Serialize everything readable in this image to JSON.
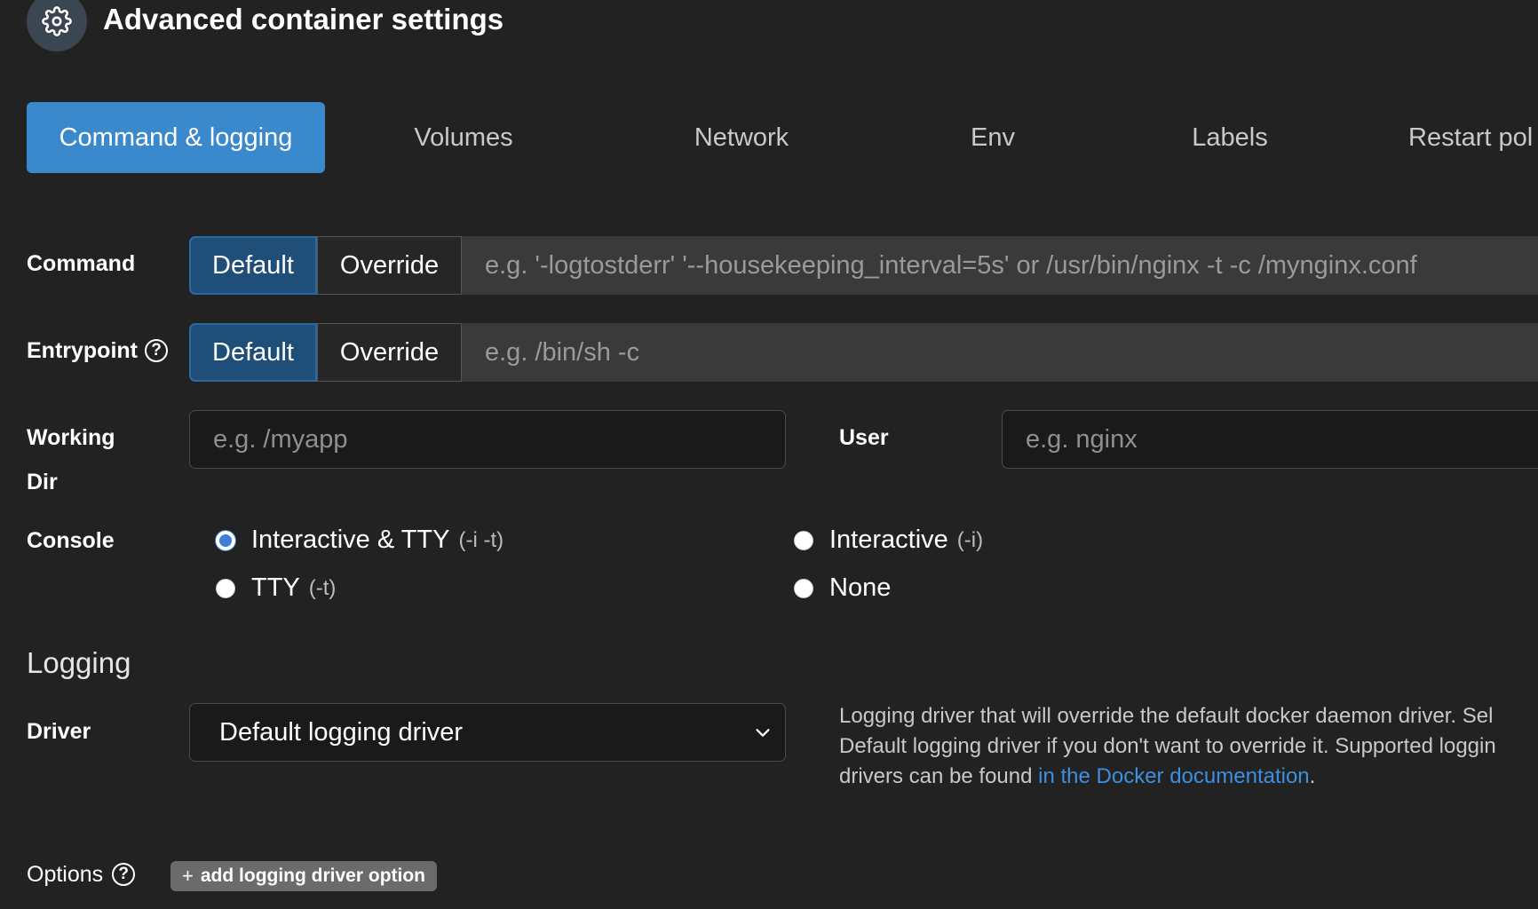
{
  "header": {
    "title": "Advanced container settings",
    "icon": "gear-icon"
  },
  "tabs": [
    {
      "label": "Command & logging",
      "active": true
    },
    {
      "label": "Volumes",
      "active": false
    },
    {
      "label": "Network",
      "active": false
    },
    {
      "label": "Env",
      "active": false
    },
    {
      "label": "Labels",
      "active": false
    },
    {
      "label": "Restart pol",
      "active": false
    }
  ],
  "command": {
    "label": "Command",
    "default_label": "Default",
    "override_label": "Override",
    "placeholder": "e.g. '-logtostderr' '--housekeeping_interval=5s' or /usr/bin/nginx -t -c /mynginx.conf"
  },
  "entrypoint": {
    "label": "Entrypoint",
    "default_label": "Default",
    "override_label": "Override",
    "placeholder": "e.g. /bin/sh -c"
  },
  "working_dir": {
    "label_line1": "Working",
    "label_line2": "Dir",
    "placeholder": "e.g. /myapp"
  },
  "user": {
    "label": "User",
    "placeholder": "e.g. nginx"
  },
  "console": {
    "label": "Console",
    "options": [
      {
        "label": "Interactive & TTY",
        "flag": "(-i -t)",
        "checked": true
      },
      {
        "label": "Interactive",
        "flag": "(-i)",
        "checked": false
      },
      {
        "label": "TTY",
        "flag": "(-t)",
        "checked": false
      },
      {
        "label": "None",
        "flag": "",
        "checked": false
      }
    ]
  },
  "logging": {
    "section_title": "Logging",
    "driver_label": "Driver",
    "driver_value": "Default logging driver",
    "help_line1": "Logging driver that will override the default docker daemon driver. Sel",
    "help_line2": "Default logging driver if you don't want to override it. Supported loggin",
    "help_line3_prefix": "drivers can be found ",
    "help_link": "in the Docker documentation",
    "help_line3_suffix": ".",
    "options_label": "Options",
    "add_option_label": "add logging driver option"
  }
}
